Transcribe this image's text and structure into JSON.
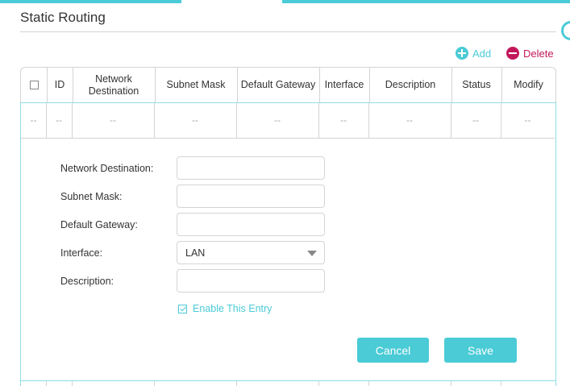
{
  "page": {
    "title": "Static Routing"
  },
  "toolbar": {
    "add_label": "Add",
    "delete_label": "Delete"
  },
  "table": {
    "columns": [
      "ID",
      "Network Destination",
      "Subnet Mask",
      "Default Gateway",
      "Interface",
      "Description",
      "Status",
      "Modify"
    ],
    "row": [
      "--",
      "--",
      "--",
      "--",
      "--",
      "--",
      "--",
      "--",
      "--"
    ]
  },
  "form": {
    "labels": {
      "network_destination": "Network Destination:",
      "subnet_mask": "Subnet Mask:",
      "default_gateway": "Default Gateway:",
      "interface": "Interface:",
      "description": "Description:"
    },
    "values": {
      "network_destination": "",
      "subnet_mask": "",
      "default_gateway": "",
      "interface": "LAN",
      "description": ""
    },
    "enable_label": "Enable This Entry",
    "enable_checked": true,
    "cancel_label": "Cancel",
    "save_label": "Save"
  },
  "colors": {
    "accent": "#4acbd6",
    "delete": "#c2185b",
    "border": "#d4d4d4"
  },
  "icons": {
    "add": "plus-circle-icon",
    "delete": "minus-circle-icon",
    "help": "help-icon"
  }
}
